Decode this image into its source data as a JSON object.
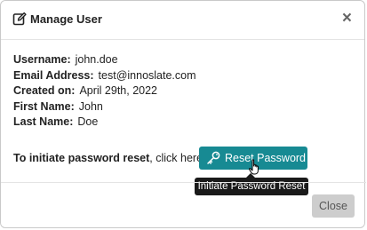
{
  "modal": {
    "title": "Manage User",
    "close_glyph": "×"
  },
  "user": {
    "fields": [
      {
        "label": "Username:",
        "value": "john.doe"
      },
      {
        "label": "Email Address:",
        "value": "test@innoslate.com"
      },
      {
        "label": "Created on:",
        "value": "April 29th, 2022"
      },
      {
        "label": "First Name:",
        "value": "John"
      },
      {
        "label": "Last Name:",
        "value": "Doe"
      }
    ]
  },
  "reset": {
    "prompt_bold": "To initiate password reset",
    "prompt_rest": ", click here:",
    "button_label": "Reset Password",
    "tooltip": "Initiate Password Reset"
  },
  "footer": {
    "close_label": "Close"
  },
  "icons": {
    "title": "edit-icon",
    "reset": "key-icon",
    "pointer": "hand-pointer-icon"
  },
  "colors": {
    "primary": "#178a93",
    "tooltip_bg": "#1a1a1a",
    "close_button_bg": "#cdcdcd"
  }
}
